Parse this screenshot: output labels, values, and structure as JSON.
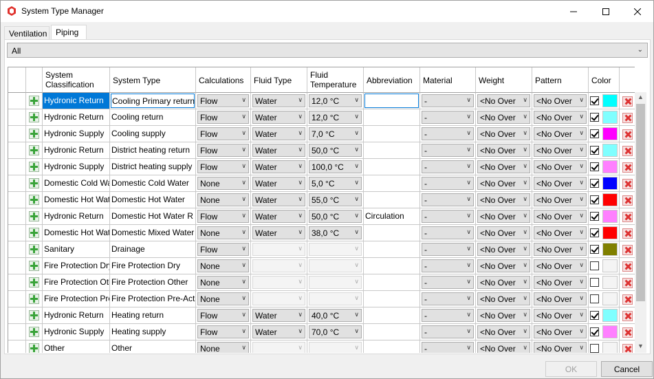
{
  "window": {
    "title": "System Type Manager"
  },
  "tabs": [
    {
      "label": "Ventilation"
    },
    {
      "label": "Piping"
    }
  ],
  "filter": {
    "value": "All"
  },
  "headers": {
    "classification": "System\nClassification",
    "system_type": "System Type",
    "calculations": "Calculations",
    "fluid_type": "Fluid Type",
    "fluid_temperature": "Fluid\nTemperature",
    "abbreviation": "Abbreviation",
    "material": "Material",
    "weight": "Weight",
    "pattern": "Pattern",
    "color": "Color"
  },
  "rows": [
    {
      "classification": "Hydronic Return",
      "system_type": "Cooling Primary return",
      "calculations": "Flow",
      "fluid_type": "Water",
      "temperature": "12,0 °C",
      "abbreviation": "",
      "material": "-",
      "weight": "<No Over",
      "pattern": "<No Over",
      "checked": true,
      "color": "#00ffff"
    },
    {
      "classification": "Hydronic Return",
      "system_type": "Cooling return",
      "calculations": "Flow",
      "fluid_type": "Water",
      "temperature": "12,0 °C",
      "abbreviation": "",
      "material": "-",
      "weight": "<No Over",
      "pattern": "<No Over",
      "checked": true,
      "color": "#80ffff"
    },
    {
      "classification": "Hydronic Supply",
      "system_type": "Cooling supply",
      "calculations": "Flow",
      "fluid_type": "Water",
      "temperature": "7,0 °C",
      "abbreviation": "",
      "material": "-",
      "weight": "<No Over",
      "pattern": "<No Over",
      "checked": true,
      "color": "#ff00ff"
    },
    {
      "classification": "Hydronic Return",
      "system_type": "District heating return",
      "calculations": "Flow",
      "fluid_type": "Water",
      "temperature": "50,0 °C",
      "abbreviation": "",
      "material": "-",
      "weight": "<No Over",
      "pattern": "<No Over",
      "checked": true,
      "color": "#80ffff"
    },
    {
      "classification": "Hydronic Supply",
      "system_type": "District heating supply",
      "calculations": "Flow",
      "fluid_type": "Water",
      "temperature": "100,0 °C",
      "abbreviation": "",
      "material": "-",
      "weight": "<No Over",
      "pattern": "<No Over",
      "checked": true,
      "color": "#ff80ff"
    },
    {
      "classification": "Domestic Cold Wa",
      "system_type": "Domestic Cold Water",
      "calculations": "None",
      "fluid_type": "Water",
      "temperature": "5,0 °C",
      "abbreviation": "",
      "material": "-",
      "weight": "<No Over",
      "pattern": "<No Over",
      "checked": true,
      "color": "#0000ff"
    },
    {
      "classification": "Domestic Hot Wat",
      "system_type": "Domestic Hot Water",
      "calculations": "None",
      "fluid_type": "Water",
      "temperature": "55,0 °C",
      "abbreviation": "",
      "material": "-",
      "weight": "<No Over",
      "pattern": "<No Over",
      "checked": true,
      "color": "#ff0000"
    },
    {
      "classification": "Hydronic Return",
      "system_type": "Domestic Hot Water R",
      "calculations": "Flow",
      "fluid_type": "Water",
      "temperature": "50,0 °C",
      "abbreviation": "Circulation",
      "material": "-",
      "weight": "<No Over",
      "pattern": "<No Over",
      "checked": true,
      "color": "#ff80ff"
    },
    {
      "classification": "Domestic Hot Wat",
      "system_type": "Domestic Mixed Water",
      "calculations": "None",
      "fluid_type": "Water",
      "temperature": "38,0 °C",
      "abbreviation": "",
      "material": "-",
      "weight": "<No Over",
      "pattern": "<No Over",
      "checked": true,
      "color": "#ff0000"
    },
    {
      "classification": "Sanitary",
      "system_type": "Drainage",
      "calculations": "Flow",
      "fluid_type": "",
      "temperature": "",
      "abbreviation": "",
      "material": "-",
      "weight": "<No Over",
      "pattern": "<No Over",
      "checked": true,
      "color": "#808000"
    },
    {
      "classification": "Fire Protection Dry",
      "system_type": "Fire Protection Dry",
      "calculations": "None",
      "fluid_type": "",
      "temperature": "",
      "abbreviation": "",
      "material": "-",
      "weight": "<No Over",
      "pattern": "<No Over",
      "checked": false,
      "color": "#f4f4f4"
    },
    {
      "classification": "Fire Protection Oth",
      "system_type": "Fire Protection Other",
      "calculations": "None",
      "fluid_type": "",
      "temperature": "",
      "abbreviation": "",
      "material": "-",
      "weight": "<No Over",
      "pattern": "<No Over",
      "checked": false,
      "color": "#f4f4f4"
    },
    {
      "classification": "Fire Protection Pre",
      "system_type": "Fire Protection Pre-Act",
      "calculations": "None",
      "fluid_type": "",
      "temperature": "",
      "abbreviation": "",
      "material": "-",
      "weight": "<No Over",
      "pattern": "<No Over",
      "checked": false,
      "color": "#f4f4f4"
    },
    {
      "classification": "Hydronic Return",
      "system_type": "Heating return",
      "calculations": "Flow",
      "fluid_type": "Water",
      "temperature": "40,0 °C",
      "abbreviation": "",
      "material": "-",
      "weight": "<No Over",
      "pattern": "<No Over",
      "checked": true,
      "color": "#80ffff"
    },
    {
      "classification": "Hydronic Supply",
      "system_type": "Heating supply",
      "calculations": "Flow",
      "fluid_type": "Water",
      "temperature": "70,0 °C",
      "abbreviation": "",
      "material": "-",
      "weight": "<No Over",
      "pattern": "<No Over",
      "checked": true,
      "color": "#ff80ff"
    },
    {
      "classification": "Other",
      "system_type": "Other",
      "calculations": "None",
      "fluid_type": "",
      "temperature": "",
      "abbreviation": "",
      "material": "-",
      "weight": "<No Over",
      "pattern": "<No Over",
      "checked": false,
      "color": "#f4f4f4"
    }
  ],
  "buttons": {
    "ok": "OK",
    "cancel": "Cancel"
  },
  "colors": {
    "selection": "#0078d7",
    "add": "#39a339",
    "delete": "#d33333"
  },
  "icons": {
    "app": "revit-logo-icon",
    "add": "plus-icon",
    "delete": "x-icon"
  }
}
